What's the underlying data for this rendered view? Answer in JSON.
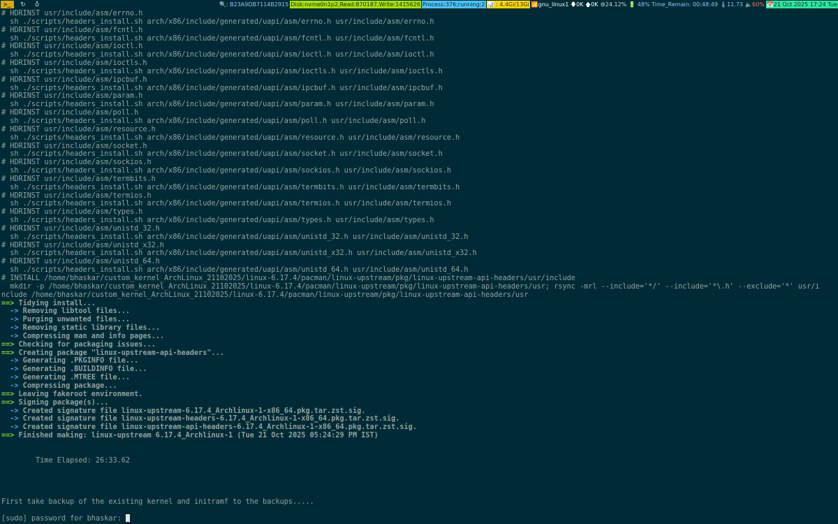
{
  "statusbar": {
    "workspaces": [
      {
        "label": "≻_",
        "icon": "terminal-icon"
      },
      {
        "label": "↻",
        "icon": "refresh-icon"
      },
      {
        "label": "♁",
        "icon": "drop-icon"
      }
    ],
    "host": "🔍: B23A9DB7114B2915",
    "disk": "Disk:nvme0n1p2,Read:870187,Write:1415626",
    "process": "Process:376;running:2",
    "memory": "📊 : 4.4Gi/13Gi",
    "network": "📶gnu_linux1 🡇0K 🡅0K",
    "cpu": "⚙24.12%",
    "battery": "🔋 48% Time_Remain: 00:48:49",
    "temp": "🌡11.73",
    "volume": "🔈60%",
    "datetime": "📅21 Oct 2025 17:24 Tue"
  },
  "terminal": {
    "lines": [
      {
        "t": "plain",
        "text": "# HDRINST usr/include/asm/errno.h"
      },
      {
        "t": "plain",
        "text": "  sh ./scripts/headers_install.sh arch/x86/include/generated/uapi/asm/errno.h usr/include/asm/errno.h"
      },
      {
        "t": "plain",
        "text": "# HDRINST usr/include/asm/fcntl.h"
      },
      {
        "t": "plain",
        "text": "  sh ./scripts/headers_install.sh arch/x86/include/generated/uapi/asm/fcntl.h usr/include/asm/fcntl.h"
      },
      {
        "t": "plain",
        "text": "# HDRINST usr/include/asm/ioctl.h"
      },
      {
        "t": "plain",
        "text": "  sh ./scripts/headers_install.sh arch/x86/include/generated/uapi/asm/ioctl.h usr/include/asm/ioctl.h"
      },
      {
        "t": "plain",
        "text": "# HDRINST usr/include/asm/ioctls.h"
      },
      {
        "t": "plain",
        "text": "  sh ./scripts/headers_install.sh arch/x86/include/generated/uapi/asm/ioctls.h usr/include/asm/ioctls.h"
      },
      {
        "t": "plain",
        "text": "# HDRINST usr/include/asm/ipcbuf.h"
      },
      {
        "t": "plain",
        "text": "  sh ./scripts/headers_install.sh arch/x86/include/generated/uapi/asm/ipcbuf.h usr/include/asm/ipcbuf.h"
      },
      {
        "t": "plain",
        "text": "# HDRINST usr/include/asm/param.h"
      },
      {
        "t": "plain",
        "text": "  sh ./scripts/headers_install.sh arch/x86/include/generated/uapi/asm/param.h usr/include/asm/param.h"
      },
      {
        "t": "plain",
        "text": "# HDRINST usr/include/asm/poll.h"
      },
      {
        "t": "plain",
        "text": "  sh ./scripts/headers_install.sh arch/x86/include/generated/uapi/asm/poll.h usr/include/asm/poll.h"
      },
      {
        "t": "plain",
        "text": "# HDRINST usr/include/asm/resource.h"
      },
      {
        "t": "plain",
        "text": "  sh ./scripts/headers_install.sh arch/x86/include/generated/uapi/asm/resource.h usr/include/asm/resource.h"
      },
      {
        "t": "plain",
        "text": "# HDRINST usr/include/asm/socket.h"
      },
      {
        "t": "plain",
        "text": "  sh ./scripts/headers_install.sh arch/x86/include/generated/uapi/asm/socket.h usr/include/asm/socket.h"
      },
      {
        "t": "plain",
        "text": "# HDRINST usr/include/asm/sockios.h"
      },
      {
        "t": "plain",
        "text": "  sh ./scripts/headers_install.sh arch/x86/include/generated/uapi/asm/sockios.h usr/include/asm/sockios.h"
      },
      {
        "t": "plain",
        "text": "# HDRINST usr/include/asm/termbits.h"
      },
      {
        "t": "plain",
        "text": "  sh ./scripts/headers_install.sh arch/x86/include/generated/uapi/asm/termbits.h usr/include/asm/termbits.h"
      },
      {
        "t": "plain",
        "text": "# HDRINST usr/include/asm/termios.h"
      },
      {
        "t": "plain",
        "text": "  sh ./scripts/headers_install.sh arch/x86/include/generated/uapi/asm/termios.h usr/include/asm/termios.h"
      },
      {
        "t": "plain",
        "text": "# HDRINST usr/include/asm/types.h"
      },
      {
        "t": "plain",
        "text": "  sh ./scripts/headers_install.sh arch/x86/include/generated/uapi/asm/types.h usr/include/asm/types.h"
      },
      {
        "t": "plain",
        "text": "# HDRINST usr/include/asm/unistd_32.h"
      },
      {
        "t": "plain",
        "text": "  sh ./scripts/headers_install.sh arch/x86/include/generated/uapi/asm/unistd_32.h usr/include/asm/unistd_32.h"
      },
      {
        "t": "plain",
        "text": "# HDRINST usr/include/asm/unistd_x32.h"
      },
      {
        "t": "plain",
        "text": "  sh ./scripts/headers_install.sh arch/x86/include/generated/uapi/asm/unistd_x32.h usr/include/asm/unistd_x32.h"
      },
      {
        "t": "plain",
        "text": "# HDRINST usr/include/asm/unistd_64.h"
      },
      {
        "t": "plain",
        "text": "  sh ./scripts/headers_install.sh arch/x86/include/generated/uapi/asm/unistd_64.h usr/include/asm/unistd_64.h"
      },
      {
        "t": "plain",
        "text": "# INSTALL /home/bhaskar/custom_kernel_ArchLinux_21102025/linux-6.17.4/pacman/linux-upstream/pkg/linux-upstream-api-headers/usr/include"
      },
      {
        "t": "plain",
        "text": "  mkdir -p /home/bhaskar/custom_kernel_ArchLinux_21102025/linux-6.17.4/pacman/linux-upstream/pkg/linux-upstream-api-headers/usr; rsync -mrl --include='*/' --include='*\\.h' --exclude='*' usr/i"
      },
      {
        "t": "plain",
        "text": "nclude /home/bhaskar/custom_kernel_ArchLinux_21102025/linux-6.17.4/pacman/linux-upstream/pkg/linux-upstream-api-headers/usr"
      },
      {
        "t": "green",
        "prefix": "==>",
        "text": " Tidying install..."
      },
      {
        "t": "blue",
        "prefix": "  ->",
        "text": " Removing libtool files..."
      },
      {
        "t": "blue",
        "prefix": "  ->",
        "text": " Purging unwanted files..."
      },
      {
        "t": "blue",
        "prefix": "  ->",
        "text": " Removing static library files..."
      },
      {
        "t": "blue",
        "prefix": "  ->",
        "text": " Compressing man and info pages..."
      },
      {
        "t": "green",
        "prefix": "==>",
        "text": " Checking for packaging issues..."
      },
      {
        "t": "green",
        "prefix": "==>",
        "text": " Creating package \"linux-upstream-api-headers\"..."
      },
      {
        "t": "blue",
        "prefix": "  ->",
        "text": " Generating .PKGINFO file..."
      },
      {
        "t": "blue",
        "prefix": "  ->",
        "text": " Generating .BUILDINFO file..."
      },
      {
        "t": "blue",
        "prefix": "  ->",
        "text": " Generating .MTREE file..."
      },
      {
        "t": "blue",
        "prefix": "  ->",
        "text": " Compressing package..."
      },
      {
        "t": "green",
        "prefix": "==>",
        "text": " Leaving fakeroot environment."
      },
      {
        "t": "green",
        "prefix": "==>",
        "text": " Signing package(s)..."
      },
      {
        "t": "blue",
        "prefix": "  ->",
        "text": " Created signature file linux-upstream-6.17.4_Archlinux-1-x86_64.pkg.tar.zst.sig."
      },
      {
        "t": "blue",
        "prefix": "  ->",
        "text": " Created signature file linux-upstream-headers-6.17.4_Archlinux-1-x86_64.pkg.tar.zst.sig."
      },
      {
        "t": "blue",
        "prefix": "  ->",
        "text": " Created signature file linux-upstream-api-headers-6.17.4_Archlinux-1-x86_64.pkg.tar.zst.sig."
      },
      {
        "t": "green",
        "prefix": "==>",
        "text": " Finished making: linux-upstream 6.17.4_Archlinux-1 (Tue 21 Oct 2025 05:24:29 PM IST)"
      },
      {
        "t": "blank",
        "text": ""
      },
      {
        "t": "blank",
        "text": ""
      },
      {
        "t": "plain",
        "text": "        Time Elapsed: 26:33.62"
      },
      {
        "t": "blank",
        "text": ""
      },
      {
        "t": "blank",
        "text": ""
      },
      {
        "t": "blank",
        "text": ""
      },
      {
        "t": "blank",
        "text": ""
      },
      {
        "t": "plain",
        "text": "First take backup of the existing kernel and initramf to the backups....."
      },
      {
        "t": "blank",
        "text": ""
      },
      {
        "t": "prompt",
        "text": "[sudo] password for bhaskar: "
      }
    ]
  }
}
